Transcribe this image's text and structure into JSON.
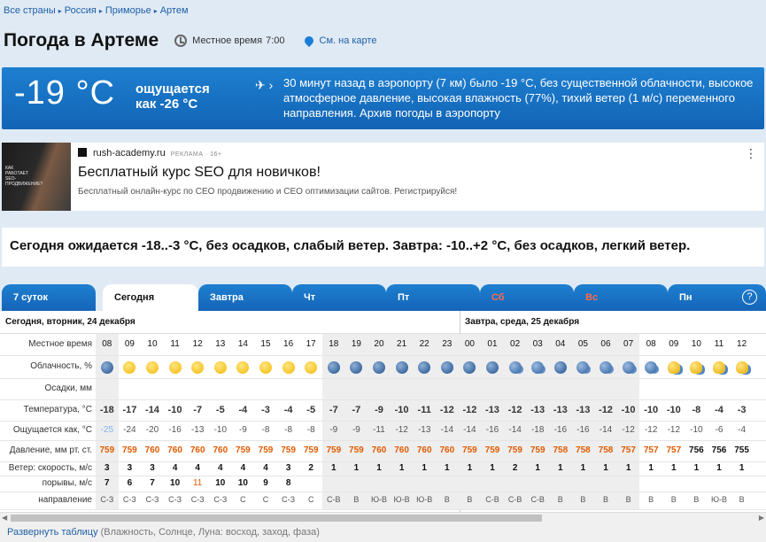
{
  "breadcrumbs": [
    "Все страны",
    "Россия",
    "Приморье",
    "Артем"
  ],
  "page_title": "Погода в Артеме",
  "local_time_label": "Местное время",
  "local_time_value": "7:00",
  "map_link": "См. на карте",
  "now": {
    "temp": "-19 °C",
    "feels": "ощущается как -26 °C",
    "airport_text": "30 минут назад в аэропорту (7 км) было -19 °C, без существенной облачности, высокое атмосферное давление, высокая влажность (77%), тихий ветер (1 м/с) переменного направления. Архив погоды в аэропорту"
  },
  "ad": {
    "image_text": "КАК РАБОТАЕТ SEO-ПРОДВИЖЕНИЕ?",
    "domain": "rush-academy.ru",
    "label": "РЕКЛАМА · 16+",
    "title": "Бесплатный курс SEO для новичков!",
    "text": "Бесплатный онлайн-курс по СЕО продвижению и СЕО оптимизации сайтов. Регистрируйся!",
    "menu": "⋮"
  },
  "forecast_text": "Сегодня ожидается -18..-3 °C, без осадков, слабый ветер. Завтра: -10..+2 °C, без осадков, легкий ветер.",
  "tabs": [
    {
      "label": "7 суток"
    },
    {
      "label": "Сегодня"
    },
    {
      "label": "Завтра"
    },
    {
      "label": "Чт"
    },
    {
      "label": "Пт"
    },
    {
      "label": "Сб"
    },
    {
      "label": "Вс"
    },
    {
      "label": "Пн"
    }
  ],
  "help": "?",
  "day_today": "Сегодня, вторник, 24 декабря",
  "day_tomorrow": "Завтра, среда, 25 декабря",
  "labels": {
    "time": "Местное время",
    "clouds": "Облачность, %",
    "precip": "Осадки, мм",
    "temp": "Температура, °C",
    "feels": "Ощущается как, °C",
    "pressure": "Давление, мм рт. ст.",
    "wind_speed": "Ветер: скорость, м/с",
    "gusts": "порывы, м/с",
    "direction": "направление"
  },
  "hours": [
    "08",
    "09",
    "10",
    "11",
    "12",
    "13",
    "14",
    "15",
    "16",
    "17",
    "18",
    "19",
    "20",
    "21",
    "22",
    "23",
    "00",
    "01",
    "02",
    "03",
    "04",
    "05",
    "06",
    "07",
    "08",
    "09",
    "10",
    "11",
    "12"
  ],
  "clouds": [
    "moon",
    "sun",
    "sun",
    "sun",
    "sun",
    "sun",
    "sun",
    "sun",
    "sun",
    "sun",
    "moon",
    "moon",
    "moon",
    "moon",
    "moon",
    "moon",
    "moon",
    "moon",
    "cloudy-night",
    "cloudy-night",
    "moon",
    "cloudy-night",
    "cloudy-night",
    "cloudy-night",
    "cloudy-night",
    "sun-cloud",
    "sun-cloud",
    "sun-cloud",
    "sun-cloud"
  ],
  "temps": [
    "-18",
    "-17",
    "-14",
    "-10",
    "-7",
    "-5",
    "-4",
    "-3",
    "-4",
    "-5",
    "-7",
    "-7",
    "-9",
    "-10",
    "-11",
    "-12",
    "-12",
    "-13",
    "-12",
    "-13",
    "-13",
    "-13",
    "-12",
    "-10",
    "-10",
    "-10",
    "-8",
    "-4",
    "-3"
  ],
  "feels": [
    "-25",
    "-24",
    "-20",
    "-16",
    "-13",
    "-10",
    "-9",
    "-8",
    "-8",
    "-8",
    "-9",
    "-9",
    "-11",
    "-12",
    "-13",
    "-14",
    "-14",
    "-16",
    "-14",
    "-18",
    "-16",
    "-16",
    "-14",
    "-12",
    "-12",
    "-12",
    "-10",
    "-6",
    "-4"
  ],
  "pressure": [
    "759",
    "759",
    "760",
    "760",
    "760",
    "760",
    "759",
    "759",
    "759",
    "759",
    "759",
    "759",
    "760",
    "760",
    "760",
    "760",
    "759",
    "759",
    "759",
    "759",
    "758",
    "758",
    "758",
    "757",
    "757",
    "757",
    "756",
    "756",
    "755"
  ],
  "pressure_black_from": 26,
  "wind": [
    "3",
    "3",
    "3",
    "4",
    "4",
    "4",
    "4",
    "4",
    "3",
    "2",
    "1",
    "1",
    "1",
    "1",
    "1",
    "1",
    "1",
    "1",
    "2",
    "1",
    "1",
    "1",
    "1",
    "1",
    "1",
    "1",
    "1",
    "1",
    "1"
  ],
  "gusts": [
    "7",
    "6",
    "7",
    "10",
    "11",
    "10",
    "10",
    "9",
    "8",
    "",
    "",
    "",
    "",
    "",
    "",
    "",
    "",
    "",
    "",
    "",
    "",
    "",
    "",
    "",
    "",
    "",
    "",
    "",
    ""
  ],
  "gust_highlight_index": 4,
  "directions": [
    "С-З",
    "С-З",
    "С-З",
    "С-З",
    "С-З",
    "С-З",
    "С",
    "С",
    "С-З",
    "С",
    "С-В",
    "В",
    "Ю-В",
    "Ю-В",
    "Ю-В",
    "В",
    "В",
    "С-В",
    "С-В",
    "С-В",
    "В",
    "В",
    "В",
    "В",
    "В",
    "В",
    "В",
    "Ю-В",
    "В"
  ],
  "expand_link": "Развернуть таблицу",
  "expand_hint": "(Влажность, Солнце, Луна: восход, заход, фаза)"
}
